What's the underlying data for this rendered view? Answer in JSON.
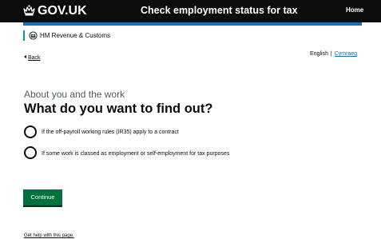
{
  "header": {
    "logo_text": "GOV.UK",
    "service_name": "Check employment status for tax",
    "home_label": "Home",
    "colors": {
      "background": "#0b0c0c",
      "accent_bar": "#1d70b8"
    }
  },
  "organisation": {
    "icon": "crest-icon",
    "name": "HM Revenue & Customs",
    "accent": "#00a19b"
  },
  "nav": {
    "back_label": "Back",
    "language": {
      "current": "English",
      "separator": "|",
      "alternate": "Cymraeg"
    }
  },
  "main": {
    "caption": "About you and the work",
    "heading": "What do you want to find out?",
    "options": [
      {
        "label": "If the off-payroll working rules (IR35) apply to a contract",
        "selected": false
      },
      {
        "label": "If some work is classed as employment or self-employment for tax purposes",
        "selected": false
      }
    ],
    "continue_label": "Continue",
    "button_color": "#00703c"
  },
  "footer": {
    "help_link": "Get help with this page."
  }
}
